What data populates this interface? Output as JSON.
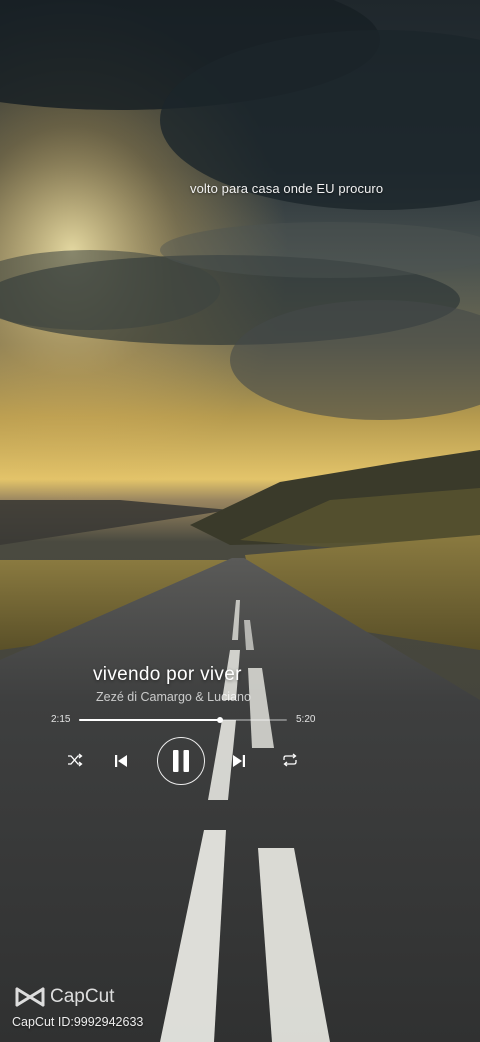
{
  "lyric": "volto para casa onde EU procuro",
  "player": {
    "song_title": "vivendo por viver",
    "artist": "Zezé di Camargo & Luciano",
    "elapsed": "2:15",
    "total": "5:20",
    "progress": 0.68,
    "state": "playing"
  },
  "controls": {
    "shuffle_icon": "shuffle-icon",
    "previous_icon": "skip-previous-icon",
    "play_pause_icon": "pause-icon",
    "next_icon": "skip-next-icon",
    "repeat_icon": "repeat-icon"
  },
  "watermark": {
    "brand": "CapCut",
    "id_text": "CapCut ID:9992942633"
  },
  "colors": {
    "text": "#ffffff",
    "progress_track": "rgba(255,255,255,0.35)",
    "progress_fill": "#ffffff"
  }
}
